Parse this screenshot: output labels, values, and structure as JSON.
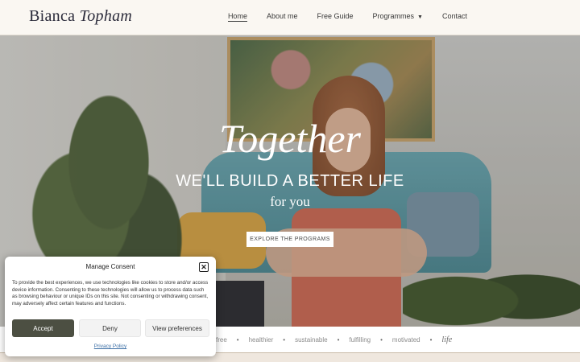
{
  "header": {
    "logo_first": "Bianca",
    "logo_last": "Topham",
    "nav": [
      {
        "label": "Home",
        "active": true
      },
      {
        "label": "About me"
      },
      {
        "label": "Free Guide"
      },
      {
        "label": "Programmes",
        "has_dropdown": true
      },
      {
        "label": "Contact"
      }
    ]
  },
  "hero": {
    "title": "Together",
    "subtitle": "WE'LL BUILD A BETTER LIFE",
    "for_you": "for you",
    "cta": "EXPLORE THE PROGRAMS"
  },
  "values_strip": {
    "items": [
      "free",
      "healthier",
      "sustainable",
      "fulfilling",
      "motivated"
    ],
    "final_italic": "life"
  },
  "consent": {
    "title": "Manage Consent",
    "body": "To provide the best experiences, we use technologies like cookies to store and/or access device information. Consenting to these technologies will allow us to process data such as browsing behaviour or unique IDs on this site. Not consenting or withdrawing consent, may adversely affect certain features and functions.",
    "accept": "Accept",
    "deny": "Deny",
    "preferences": "View preferences",
    "privacy_link": "Privacy Policy",
    "close_icon": "close-icon"
  },
  "colors": {
    "header_bg": "#faf7f2",
    "accept_bg": "#4c4f42",
    "link": "#3b6ea5"
  }
}
